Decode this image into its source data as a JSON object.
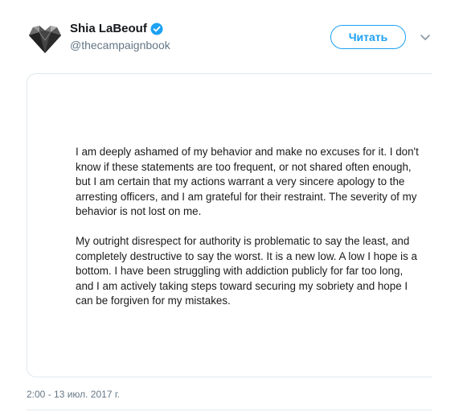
{
  "author": {
    "display_name": "Shia LaBeouf",
    "handle": "@thecampaignbook",
    "verified": true
  },
  "actions": {
    "follow_label": "Читать"
  },
  "media": {
    "statement_paragraphs": [
      "I am deeply ashamed of my behavior and make no excuses for it. I don't know if these statements are too frequent, or not shared often enough, but I am certain that my actions warrant a very sincere apology to the arresting officers, and I am grateful for their restraint. The severity of my behavior is not lost on me.",
      "My outright disrespect for authority is problematic to say the least, and completely destructive to say the worst. It is a new low. A low I hope is a bottom. I have been struggling with addiction publicly for far too long, and I am actively taking steps toward securing my sobriety and hope I can be forgiven for my mistakes."
    ]
  },
  "meta": {
    "timestamp": "2:00 - 13 июл. 2017 г."
  },
  "icons": {
    "avatar": "heart-avatar-icon",
    "verified": "verified-badge-icon",
    "caret": "chevron-down-icon"
  },
  "colors": {
    "accent": "#1da1f2",
    "text_primary": "#14171a",
    "text_secondary": "#657786",
    "border": "#e1e8ed"
  }
}
